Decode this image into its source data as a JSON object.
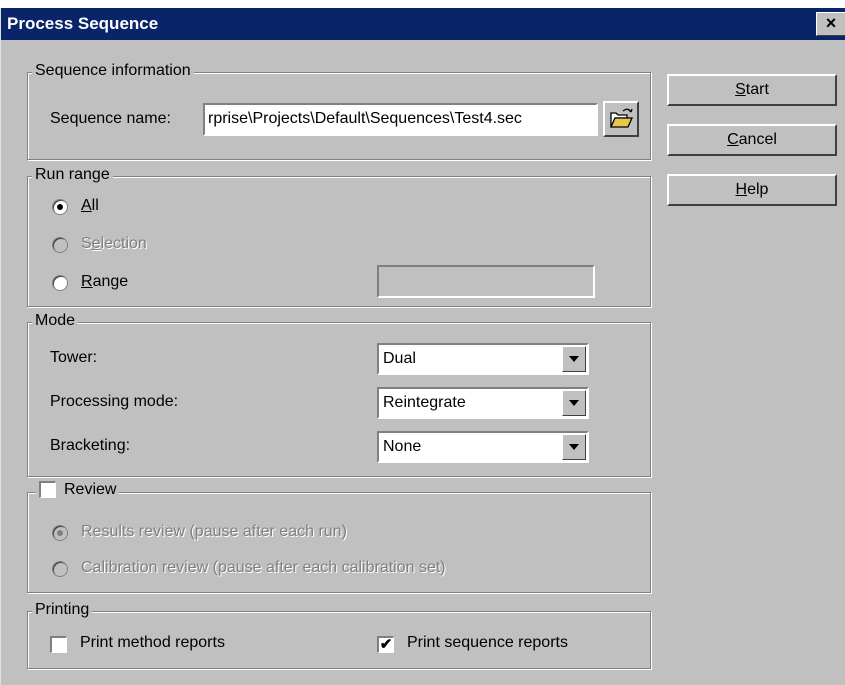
{
  "window": {
    "title": "Process Sequence",
    "close_symbol": "×"
  },
  "buttons": {
    "start": {
      "label": "Start",
      "key": "S",
      "rest": "tart"
    },
    "cancel": {
      "label": "Cancel",
      "key": "C",
      "rest": "ancel"
    },
    "help": {
      "label": "Help",
      "key": "H",
      "rest": "elp"
    }
  },
  "sequence_info": {
    "legend": "Sequence information",
    "name_label": "Sequence name:",
    "name_value": "rprise\\Projects\\Default\\Sequences\\Test4.sec"
  },
  "run_range": {
    "legend": "Run range",
    "options": [
      {
        "label": "All",
        "key": "A",
        "rest": "ll",
        "selected": true,
        "enabled": true
      },
      {
        "label": "Selection",
        "key": "e",
        "pre": "S",
        "rest": "lection",
        "selected": false,
        "enabled": false
      },
      {
        "label": "Range",
        "key": "R",
        "rest": "ange",
        "selected": false,
        "enabled": true
      }
    ],
    "range_value": ""
  },
  "mode": {
    "legend": "Mode",
    "tower_label": "Tower:",
    "tower_value": "Dual",
    "processing_label": "Processing mode:",
    "processing_value": "Reintegrate",
    "bracketing_label": "Bracketing:",
    "bracketing_value": "None"
  },
  "review": {
    "legend": "Review",
    "checked": false,
    "options": [
      {
        "label": "Results review (pause after each run)",
        "selected": true,
        "enabled": false
      },
      {
        "label": "Calibration review (pause after each calibration set)",
        "selected": false,
        "enabled": false
      }
    ]
  },
  "printing": {
    "legend": "Printing",
    "method_label": "Print method reports",
    "method_checked": false,
    "sequence_label": "Print sequence reports",
    "sequence_checked": true,
    "check_mark": "✔"
  },
  "icons": {
    "browse": "open-folder-icon",
    "combo_arrow": "chevron-down-icon"
  }
}
